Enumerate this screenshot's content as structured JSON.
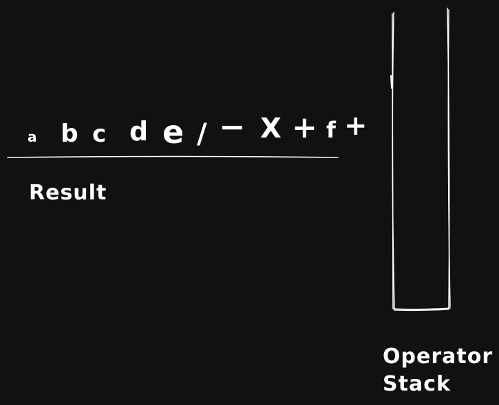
{
  "result_tokens": [
    "a",
    "b",
    "c",
    "d",
    "e",
    "/",
    "−",
    "X",
    "+",
    "f",
    "+"
  ],
  "result_label": "Result",
  "stack_label_line1": "Operator",
  "stack_label_line2": "Stack",
  "colors": {
    "background": "#121010",
    "stroke": "#ffffff"
  }
}
